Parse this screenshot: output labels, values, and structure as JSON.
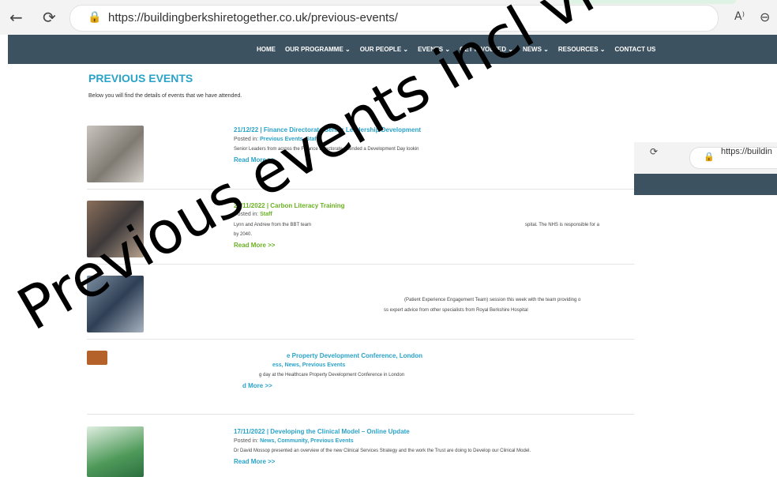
{
  "browser": {
    "url": "https://buildingberkshiretogether.co.uk/previous-events/",
    "icons": {
      "back": "←",
      "refresh": "⟳",
      "lock": "🔒",
      "read_aloud": "A⁾",
      "zoom": "⊖"
    }
  },
  "menu": [
    "HOME",
    "OUR PROGRAMME ⌄",
    "OUR PEOPLE ⌄",
    "EVENTS ⌄",
    "GET INVOLVED ⌄",
    "NEWS ⌄",
    "RESOURCES ⌄",
    "CONTACT US"
  ],
  "page": {
    "title": "PREVIOUS EVENTS",
    "intro": "Below you will find the details of events that we have attended."
  },
  "events": [
    {
      "title": "21/12/22 | Finance Directorate Senior Leadership Development",
      "posted_prefix": "Posted in:",
      "categories": "Previous Events, Staff",
      "desc": "Senior Leaders from across the Finance Directorate attended a Development Day lookin",
      "more": "Read More >>"
    },
    {
      "title": "29/11/2022 | Carbon Literacy Training",
      "posted_prefix": "Posted in:",
      "categories": "Staff",
      "desc": "Lynn and Andrew from the BBT team",
      "desc2": "spital. The NHS is responsible for a",
      "desc3": "by 2040.",
      "more": "Read More >>"
    },
    {
      "desc": "(Patient Experience Engagement Team) session this week with the team providing o",
      "desc2": "ss expert advice from other specialists from Royal Berkshire Hospital"
    },
    {
      "title": "e Property Development Conference, London",
      "categories": "ess, News, Previous Events",
      "desc": "g day at the Healthcare Property Development Conference in London",
      "more": "d More >>"
    },
    {
      "title": "17/11/2022 | Developing the Clinical Model – Online Update",
      "posted_prefix": "Posted in:",
      "categories": "News, Community, Previous Events",
      "desc": "Dr David Mossop presented an overview of the new Clinical Services Strategy and the work the Trust are doing to Develop our Clinical Model.",
      "more": "Read More >>"
    }
  ],
  "overlay": {
    "url": "https://buildin"
  },
  "watermark": "Previous events incl videos",
  "colors": {
    "nav": "#3d5260",
    "accent": "#2aa3c9",
    "green": "#6ab023"
  }
}
